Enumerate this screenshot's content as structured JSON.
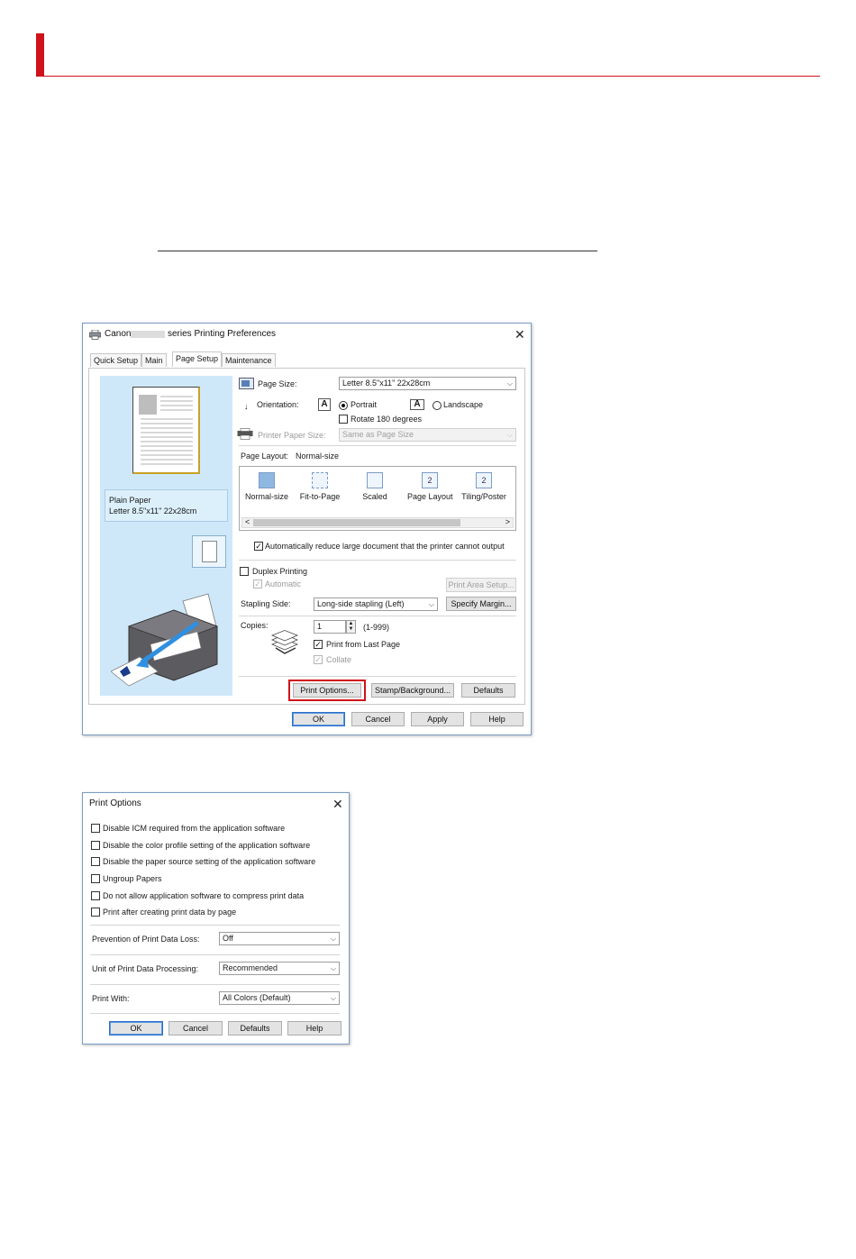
{
  "window": {
    "title_prefix": "Canon",
    "title_suffix": "series Printing Preferences",
    "close_glyph": "✕",
    "tabs": [
      "Quick Setup",
      "Main",
      "Page Setup",
      "Maintenance"
    ],
    "active_tab": "Page Setup"
  },
  "preview": {
    "media_type": "Plain Paper",
    "paper_desc": "Letter 8.5\"x11\" 22x28cm"
  },
  "page_setup": {
    "page_size_label": "Page Size:",
    "page_size_value": "Letter 8.5\"x11\" 22x28cm",
    "orientation_label": "Orientation:",
    "portrait_label": "Portrait",
    "landscape_label": "Landscape",
    "rotate_label": "Rotate 180 degrees",
    "orient_glyph": "A",
    "printer_paper_size_label": "Printer Paper Size:",
    "printer_paper_size_value": "Same as Page Size",
    "page_layout_label": "Page Layout:",
    "page_layout_value": "Normal-size",
    "layouts": [
      "Normal-size",
      "Fit-to-Page",
      "Scaled",
      "Page Layout",
      "Tiling/Poster"
    ],
    "layout_glyph": "2",
    "scroll_left": "<",
    "scroll_right": ">",
    "auto_reduce_label": "Automatically reduce large document that the printer cannot output",
    "duplex_label": "Duplex Printing",
    "automatic_label": "Automatic",
    "print_area_setup": "Print Area Setup...",
    "stapling_side_label": "Stapling Side:",
    "stapling_side_value": "Long-side stapling (Left)",
    "specify_margin": "Specify Margin...",
    "copies_label": "Copies:",
    "copies_value": "1",
    "copies_range": "(1-999)",
    "print_from_last_label": "Print from Last Page",
    "collate_label": "Collate",
    "print_options_btn": "Print Options...",
    "stamp_btn": "Stamp/Background...",
    "defaults_btn": "Defaults",
    "check_glyph": "✓",
    "dropdown_glyph": "⌵"
  },
  "footer_buttons": [
    "OK",
    "Cancel",
    "Apply",
    "Help"
  ],
  "print_options_dialog": {
    "title": "Print Options",
    "close_glyph": "✕",
    "checkboxes": [
      "Disable ICM required from the application software",
      "Disable the color profile setting of the application software",
      "Disable the paper source setting of the application software",
      "Ungroup Papers",
      "Do not allow application software to compress print data",
      "Print after creating print data by page"
    ],
    "prevention_label": "Prevention of Print Data Loss:",
    "prevention_value": "Off",
    "unit_label": "Unit of Print Data Processing:",
    "unit_value": "Recommended",
    "print_with_label": "Print With:",
    "print_with_value": "All Colors (Default)",
    "buttons": [
      "OK",
      "Cancel",
      "Defaults",
      "Help"
    ]
  },
  "colors": {
    "accent_red": "#d0121b",
    "preview_blue": "#cfe8f9",
    "default_button_blue": "#2f6fc7"
  }
}
